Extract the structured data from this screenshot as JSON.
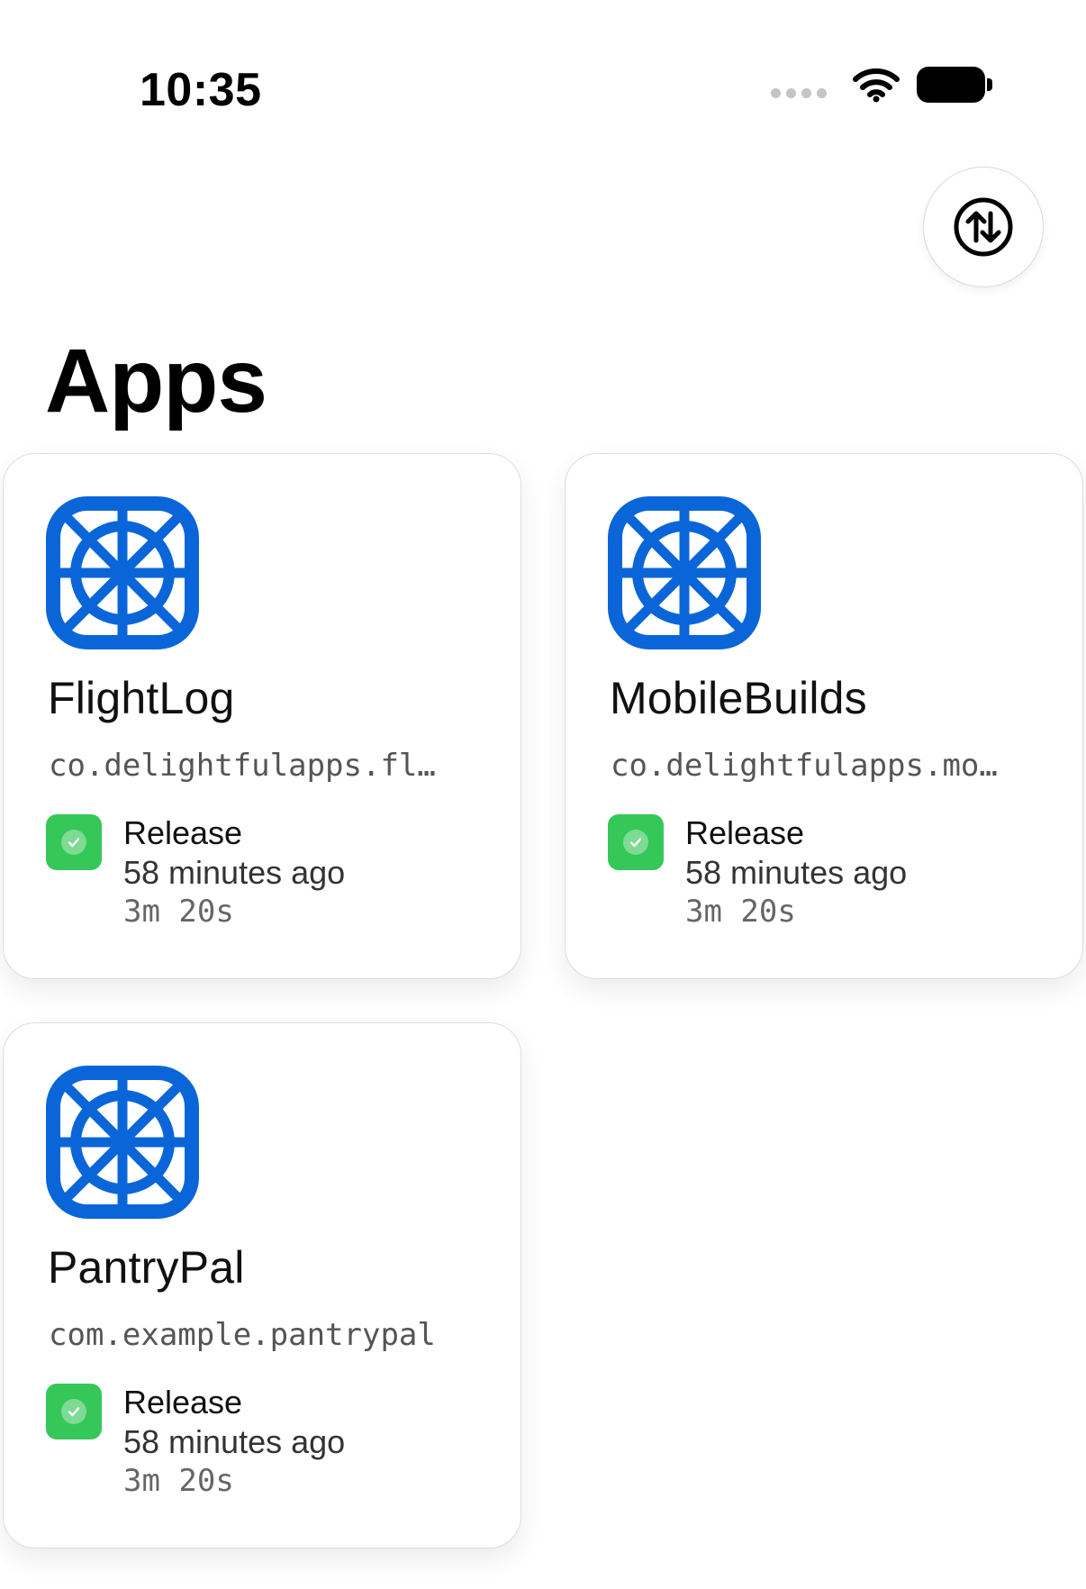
{
  "status_bar": {
    "time": "10:35"
  },
  "header": {
    "title": "Apps"
  },
  "apps": [
    {
      "name": "FlightLog",
      "bundle_id": "co.delightfulapps.fl…",
      "build": {
        "type": "Release",
        "time_ago": "58 minutes ago",
        "duration": "3m 20s",
        "status": "success"
      }
    },
    {
      "name": "MobileBuilds",
      "bundle_id": "co.delightfulapps.mo…",
      "build": {
        "type": "Release",
        "time_ago": "58 minutes ago",
        "duration": "3m 20s",
        "status": "success"
      }
    },
    {
      "name": "PantryPal",
      "bundle_id": "com.example.pantrypal",
      "build": {
        "type": "Release",
        "time_ago": "58 minutes ago",
        "duration": "3m 20s",
        "status": "success"
      }
    }
  ],
  "colors": {
    "icon_blue": "#0a66d8",
    "success_green": "#36c759"
  },
  "icons": {
    "app_icon": "ship-wheel-icon",
    "sort": "arrow-up-down-circle-icon",
    "status": "checkmark-icon"
  }
}
